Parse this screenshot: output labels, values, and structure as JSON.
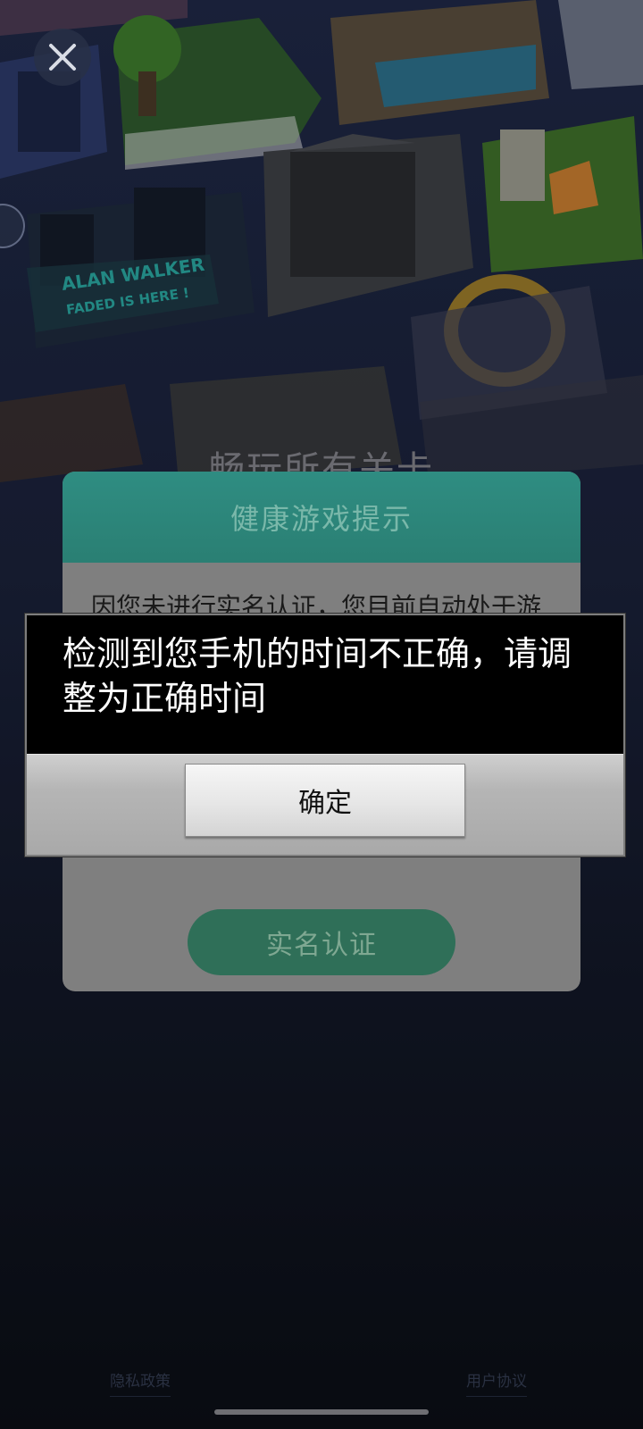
{
  "background": {
    "headline": "畅玩所有关卡",
    "art_label_1": "ALAN WALKER",
    "art_label_2": "FADED IS HERE !"
  },
  "health_card": {
    "title": "健康游戏提示",
    "body": "因您未进行实名认证，您目前自动处于游客体验模式中。根据国家新闻出版署相关要求，仅可在周五、周六、周日和法定节假日的20时至21时，向未成年人提供1小时网络游戏服务。请尽快完成实名认证以获得完整游戏体验。",
    "button_label": "实名认证"
  },
  "dialog": {
    "message": "检测到您手机的时间不正确，请调整为正确时间",
    "ok_label": "确定"
  },
  "footer": {
    "privacy_label": "隐私政策",
    "terms_label": "用户协议"
  },
  "icons": {
    "close": "close-icon"
  },
  "colors": {
    "card_header": "#2a7f73",
    "card_button": "#2f6f58",
    "dialog_bg": "#000000"
  }
}
